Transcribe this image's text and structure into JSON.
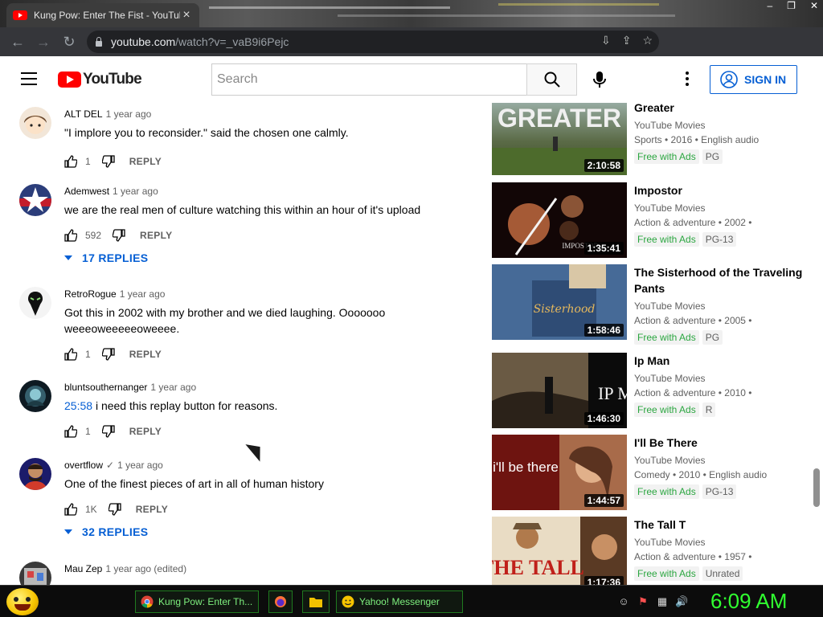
{
  "browser": {
    "tab_title": "Kung Pow: Enter The Fist - YouTube",
    "tab_close_icon": "close-icon",
    "url_host": "youtube.com",
    "url_path": "/watch?v=_vaB9i6Pejc",
    "window_controls": [
      "–",
      "❐",
      "✕"
    ]
  },
  "youtube": {
    "logo_text": "YouTube",
    "search_placeholder": "Search",
    "sign_in": "SIGN IN",
    "accent": "#065fd4",
    "brand_red": "#ff0000"
  },
  "comments": [
    {
      "author": "ALT DEL",
      "time": "1 year ago",
      "text": "\"I implore you to reconsider.\" said the chosen one calmly.",
      "likes": "1",
      "reply": "REPLY"
    },
    {
      "author": "Ademwest",
      "time": "1 year ago",
      "text": "we are the real men of culture watching this within an hour of it's upload",
      "likes": "592",
      "reply": "REPLY",
      "replies": "17 REPLIES"
    },
    {
      "author": "RetroRogue",
      "time": "1 year ago",
      "text": "Got this in 2002 with my brother and we died laughing. Ooooooo weeeoweeeeeoweeee.",
      "likes": "1",
      "reply": "REPLY"
    },
    {
      "author": "bluntsouthernanger",
      "time": "1 year ago",
      "timestamp": "25:58",
      "text": "i need this replay button for reasons.",
      "likes": "1",
      "reply": "REPLY"
    },
    {
      "author": "overtflow",
      "verified": "✓",
      "time": "1 year ago",
      "text": "One of the finest pieces of art in all of human history",
      "likes": "1K",
      "reply": "REPLY",
      "replies": "32 REPLIES"
    },
    {
      "author": "Mau Zep",
      "time": "1 year ago (edited)"
    }
  ],
  "related": [
    {
      "title": "Greater",
      "channel": "YouTube Movies",
      "meta": "Sports • 2016 • English audio",
      "free": "Free with Ads",
      "rating": "PG",
      "duration": "2:10:58",
      "thumb_text": "GREATER"
    },
    {
      "title": "Impostor",
      "channel": "YouTube Movies",
      "meta": "Action & adventure • 2002 •",
      "free": "Free with Ads",
      "rating": "PG-13",
      "duration": "1:35:41",
      "thumb_text": "IMPOSTOR"
    },
    {
      "title": "The Sisterhood of the Traveling Pants",
      "channel": "YouTube Movies",
      "meta": "Action & adventure • 2005 •",
      "free": "Free with Ads",
      "rating": "PG",
      "duration": "1:58:46",
      "thumb_text": "Sisterhood"
    },
    {
      "title": "Ip Man",
      "channel": "YouTube Movies",
      "meta": "Action & adventure • 2010 •",
      "free": "Free with Ads",
      "rating": "R",
      "duration": "1:46:30",
      "thumb_text": "IP MAN"
    },
    {
      "title": "I'll Be There",
      "channel": "YouTube Movies",
      "meta": "Comedy • 2010 • English audio",
      "free": "Free with Ads",
      "rating": "PG-13",
      "duration": "1:44:57",
      "thumb_text": "i'll be there"
    },
    {
      "title": "The Tall T",
      "channel": "YouTube Movies",
      "meta": "Action & adventure • 1957 •",
      "free": "Free with Ads",
      "rating": "Unrated",
      "duration": "1:17:36",
      "thumb_text": "THE TALL"
    }
  ],
  "taskbar": {
    "chrome_item": "Kung Pow: Enter Th...",
    "yahoo_item": "Yahoo! Messenger",
    "clock": "6:09 AM"
  }
}
